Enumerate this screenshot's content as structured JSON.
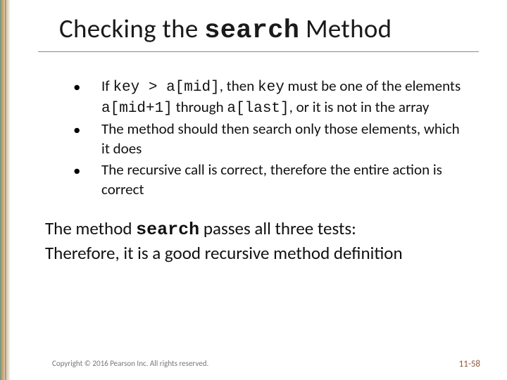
{
  "title": {
    "prefix": "Checking the ",
    "code": "search",
    "suffix": " Method"
  },
  "bullets": [
    {
      "segments": [
        {
          "t": "If "
        },
        {
          "t": "key > a[mid]",
          "mono": true
        },
        {
          "t": ", then "
        },
        {
          "t": "key",
          "mono": true
        },
        {
          "t": " must be one of the elements "
        },
        {
          "t": "a[mid+1]",
          "mono": true
        },
        {
          "t": " through "
        },
        {
          "t": "a[last]",
          "mono": true
        },
        {
          "t": ", or it is not in the array"
        }
      ]
    },
    {
      "segments": [
        {
          "t": "The method should then search only those elements, which it does"
        }
      ]
    },
    {
      "segments": [
        {
          "t": "The recursive call is correct, therefore the entire action is correct"
        }
      ]
    }
  ],
  "conclusion": {
    "line1_segments": [
      {
        "t": "The method "
      },
      {
        "t": "search",
        "mono": true
      },
      {
        "t": " passes all three tests:"
      }
    ],
    "line2": "Therefore, it is a good recursive method definition"
  },
  "footer": {
    "copyright": "Copyright © 2016 Pearson Inc. All rights reserved.",
    "page": "11-58"
  },
  "bullet_char": "•"
}
